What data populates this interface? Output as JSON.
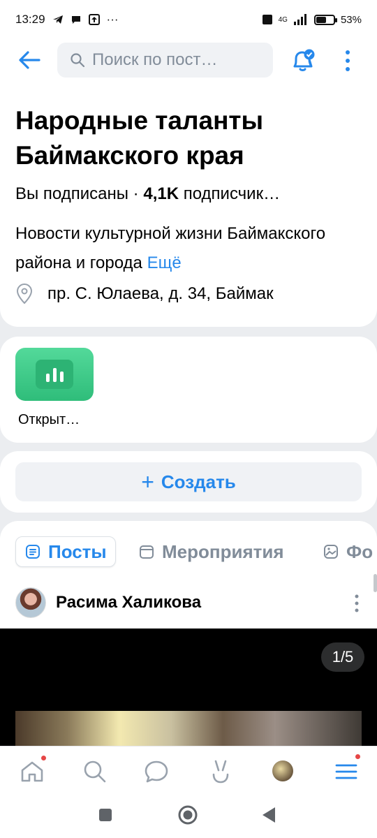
{
  "status_bar": {
    "time": "13:29",
    "network": "4G",
    "battery": "53%",
    "battery_level": 0.53
  },
  "header": {
    "search_placeholder": "Поиск по пост…"
  },
  "group": {
    "title": "Народные таланты Баймакского края",
    "subscribed": "Вы подписаны ·",
    "subscribers_count": "4,1K",
    "subscribers_label": "подписчик…",
    "description": "Новости культурной жизни Баймакского района и города",
    "more_label": "Ещё",
    "address": "пр. С. Юлаева, д. 34, Баймак"
  },
  "apps": [
    {
      "label": "Открыт…",
      "icon": "bar-chart-icon",
      "color": "#3cc98a"
    }
  ],
  "create": {
    "label": "Создать"
  },
  "tabs": [
    {
      "label": "Посты",
      "icon": "posts-icon",
      "active": true
    },
    {
      "label": "Мероприятия",
      "icon": "calendar-icon",
      "active": false
    },
    {
      "label": "Фо",
      "icon": "photo-icon",
      "active": false
    }
  ],
  "post": {
    "author": "Расима Халикова",
    "media_counter": "1/5"
  },
  "nav": [
    {
      "name": "home",
      "icon": "home-icon",
      "badge": true
    },
    {
      "name": "search",
      "icon": "search-icon",
      "badge": false
    },
    {
      "name": "messages",
      "icon": "chat-icon",
      "badge": false
    },
    {
      "name": "clips",
      "icon": "clips-icon",
      "badge": false
    },
    {
      "name": "profile",
      "icon": "avatar",
      "badge": false
    },
    {
      "name": "menu",
      "icon": "menu-icon",
      "badge": true
    }
  ],
  "colors": {
    "accent": "#2688eb",
    "text_secondary": "#818c99",
    "background": "#ebedf0"
  }
}
